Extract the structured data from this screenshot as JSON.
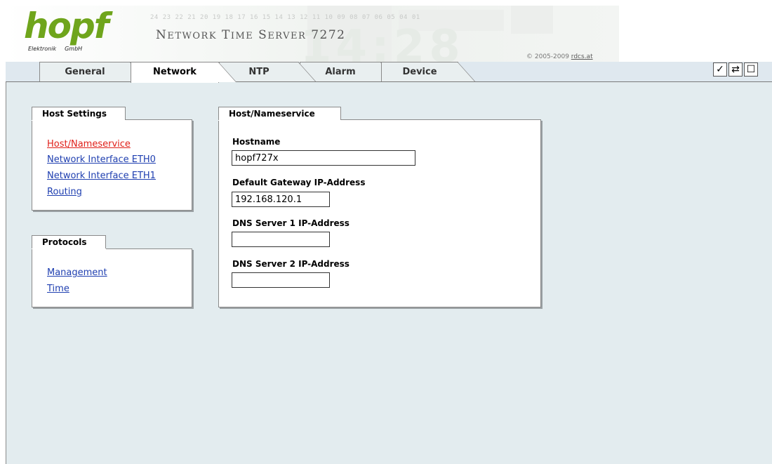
{
  "header": {
    "logo": {
      "word": "hopf",
      "sub_left": "Elektronik",
      "sub_right": "GmbH"
    },
    "digits": "24 23 22 21 20 19 18 17 16 15 14 13 12 11 10 09 08 07 06 05 04 01",
    "product": "Network Time Server 7272",
    "copyright_text": "© 2005-2009",
    "copyright_link": "rdcs.at",
    "brand_color": "#6fa51c"
  },
  "tabs": [
    {
      "label": "General",
      "active": false
    },
    {
      "label": "Network",
      "active": true
    },
    {
      "label": "NTP",
      "active": false
    },
    {
      "label": "Alarm",
      "active": false
    },
    {
      "label": "Device",
      "active": false
    }
  ],
  "toolbar": {
    "icons": [
      "check-icon",
      "reload-icon",
      "document-icon"
    ],
    "glyphs": [
      "✓",
      "⇄",
      "☐"
    ]
  },
  "sidebar": {
    "host_settings": {
      "title": "Host Settings",
      "links": [
        {
          "label": "Host/Nameservice",
          "current": true
        },
        {
          "label": "Network Interface ETH0",
          "current": false
        },
        {
          "label": "Network Interface ETH1",
          "current": false
        },
        {
          "label": "Routing",
          "current": false
        }
      ]
    },
    "protocols": {
      "title": "Protocols",
      "links": [
        {
          "label": "Management"
        },
        {
          "label": "Time"
        }
      ]
    }
  },
  "main": {
    "panel_title": "Host/Nameservice",
    "fields": [
      {
        "label": "Hostname",
        "value": "hopf727x"
      },
      {
        "label": "Default Gateway IP-Address",
        "value": "192.168.120.1"
      },
      {
        "label": "DNS Server 1 IP-Address",
        "value": ""
      },
      {
        "label": "DNS Server 2 IP-Address",
        "value": ""
      }
    ]
  },
  "colors": {
    "link": "#1f3fb0",
    "link_current": "#e0201a",
    "content_bg": "#e3ecef",
    "tabbar_bg": "#dfe8ef"
  }
}
